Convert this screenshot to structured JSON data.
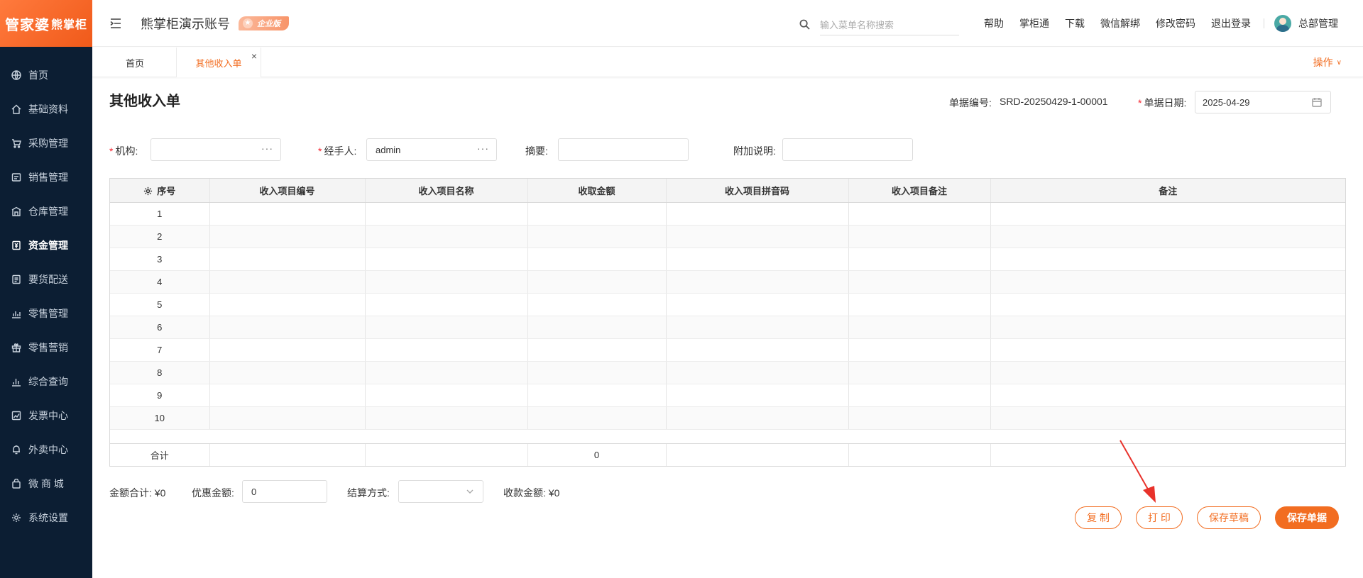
{
  "sidebar": {
    "logo_main": "管家婆",
    "logo_sub": "熊掌柜",
    "items": [
      {
        "label": "首页",
        "icon": "globe-icon"
      },
      {
        "label": "基础资料",
        "icon": "home-icon"
      },
      {
        "label": "采购管理",
        "icon": "cart-icon"
      },
      {
        "label": "销售管理",
        "icon": "receipt-icon"
      },
      {
        "label": "仓库管理",
        "icon": "warehouse-icon"
      },
      {
        "label": "资金管理",
        "icon": "money-icon",
        "active": true
      },
      {
        "label": "要货配送",
        "icon": "list-icon"
      },
      {
        "label": "零售管理",
        "icon": "chart-icon"
      },
      {
        "label": "零售营销",
        "icon": "gift-icon"
      },
      {
        "label": "综合查询",
        "icon": "bar-chart-icon"
      },
      {
        "label": "发票中心",
        "icon": "trend-icon"
      },
      {
        "label": "外卖中心",
        "icon": "bell-icon"
      },
      {
        "label": "微 商 城",
        "icon": "bag-icon"
      },
      {
        "label": "系统设置",
        "icon": "gear-icon"
      }
    ]
  },
  "header": {
    "account_title": "熊掌柜演示账号",
    "edition_badge": "企业版",
    "search_placeholder": "输入菜单名称搜索",
    "links": [
      "帮助",
      "掌柜通",
      "下载",
      "微信解绑",
      "修改密码",
      "退出登录"
    ],
    "user_name": "总部管理"
  },
  "tabs": {
    "home": "首页",
    "active": "其他收入单",
    "close": "×",
    "ops": "操作"
  },
  "form": {
    "title": "其他收入单",
    "doc_no_label": "单据编号:",
    "doc_no_value": "SRD-20250429-1-00001",
    "date_label": "单据日期:",
    "date_value": "2025-04-29",
    "org_label": "机构:",
    "org_value": "",
    "handler_label": "经手人:",
    "handler_value": "admin",
    "summary_label": "摘要:",
    "summary_value": "",
    "note_label": "附加说明:",
    "note_value": ""
  },
  "table": {
    "columns": [
      "序号",
      "收入项目编号",
      "收入项目名称",
      "收取金额",
      "收入项目拼音码",
      "收入项目备注",
      "备注"
    ],
    "rows": [
      "1",
      "2",
      "3",
      "4",
      "5",
      "6",
      "7",
      "8",
      "9",
      "10"
    ],
    "total_label": "合计",
    "total_amount": "0"
  },
  "footer": {
    "sum_label": "金额合计:",
    "sum_value": "¥0",
    "discount_label": "优惠金额:",
    "discount_value": "0",
    "settle_label": "结算方式:",
    "settle_value": "",
    "receive_label": "收款金额:",
    "receive_value": "¥0"
  },
  "buttons": {
    "copy": "复 制",
    "print": "打 印",
    "save_draft": "保存草稿",
    "save": "保存单据"
  },
  "colors": {
    "accent": "#f26d21",
    "sidebar_bg": "#0c1e33",
    "required": "#f5222d",
    "annotation_arrow": "#e8322b"
  }
}
